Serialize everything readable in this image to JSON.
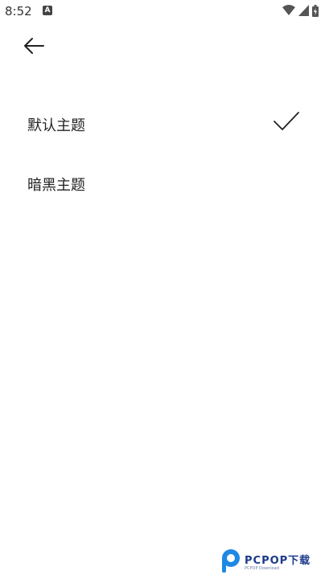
{
  "status_bar": {
    "time": "8:52",
    "notification_icon_label": "A",
    "icons": [
      "wifi-icon",
      "signal-icon",
      "battery-icon"
    ]
  },
  "toolbar": {
    "back_icon": "arrow-left-icon"
  },
  "themes": {
    "items": [
      {
        "label": "默认主题",
        "selected": true
      },
      {
        "label": "暗黑主题",
        "selected": false
      }
    ]
  },
  "watermark": {
    "text": "PCPOP下载",
    "subtext": "PCPOP Download"
  },
  "colors": {
    "background": "#ffffff",
    "text": "#222222",
    "watermark": "#1b3a8a"
  }
}
